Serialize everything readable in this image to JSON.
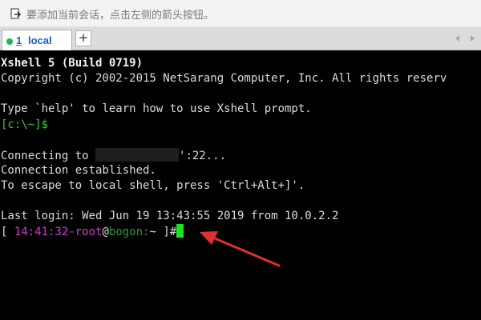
{
  "hint_bar": {
    "text": "要添加当前会话，点击左侧的箭头按钮。",
    "icon": "session-arrow-icon"
  },
  "tabs": [
    {
      "number": "1",
      "label": "local",
      "status_color": "#1fb84a",
      "active": true
    }
  ],
  "tab_add_label": "+",
  "terminal": {
    "banner_title": "Xshell 5 (Build 0719)",
    "copyright": "Copyright (c) 2002-2015 NetSarang Computer, Inc. All rights reserv",
    "help_hint": "Type `help' to learn how to use Xshell prompt.",
    "local_prompt": "[c:\\~]$",
    "connecting_prefix": "Connecting to ",
    "connecting_suffix": "':22...",
    "connection_established": "Connection established.",
    "escape_hint": "To escape to local shell, press 'Ctrl+Alt+]'.",
    "last_login": "Last login: Wed Jun 19 13:43:55 2019 from 10.0.2.2",
    "remote_prompt": {
      "open_bracket": "[ ",
      "time": "14:41:32",
      "dash": "-",
      "user": "root",
      "at": "@",
      "host": "bogon:",
      "path": "~ ",
      "close_bracket": "]",
      "symbol": "#"
    }
  },
  "colors": {
    "terminal_bg": "#000000",
    "prompt_green": "#35d135",
    "prompt_magenta": "#d23ad2",
    "cursor": "#1fe21f",
    "annotation_arrow": "#e03030"
  }
}
